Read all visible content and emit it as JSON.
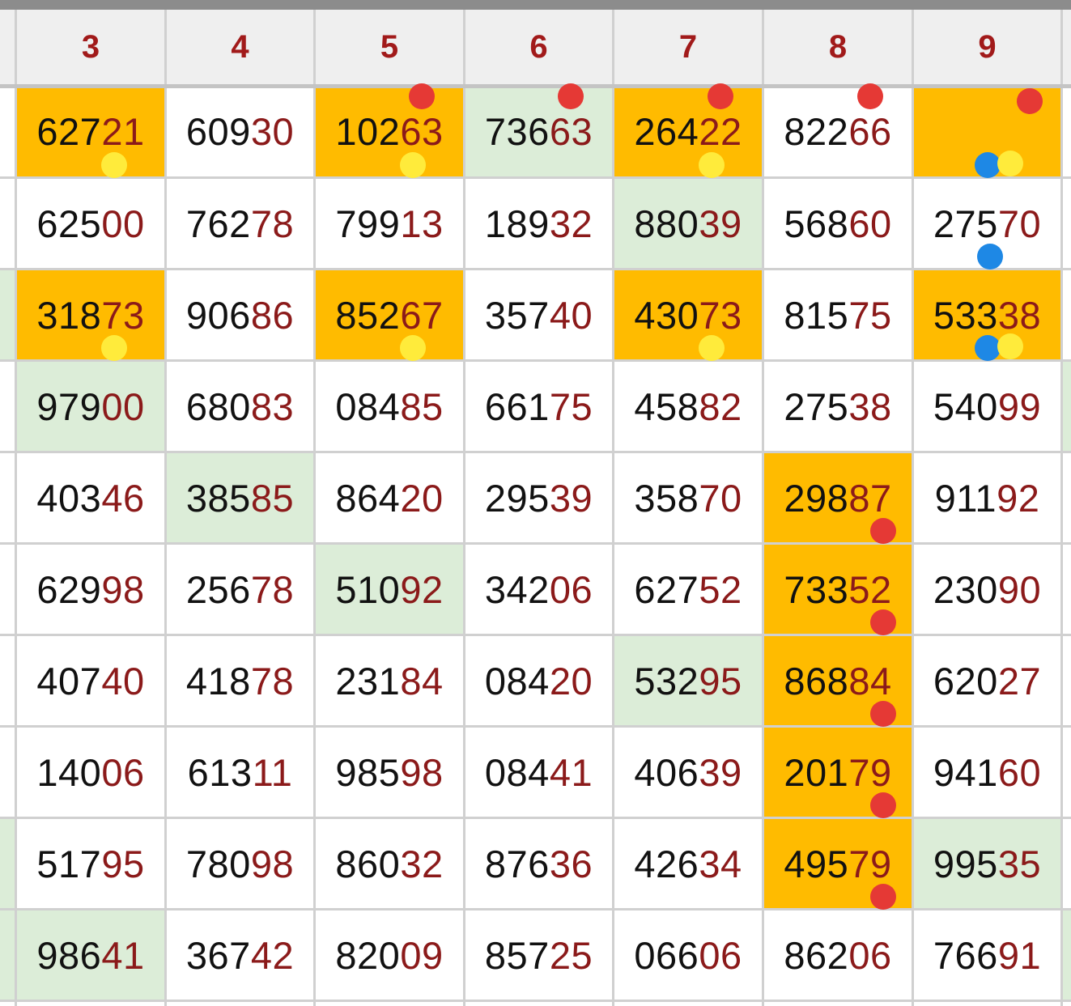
{
  "headers": [
    "3",
    "4",
    "5",
    "6",
    "7",
    "8",
    "9"
  ],
  "rows": [
    [
      "62721",
      "60930",
      "10263",
      "73663",
      "26422",
      "82266",
      ""
    ],
    [
      "62500",
      "76278",
      "79913",
      "18932",
      "88039",
      "56860",
      "27570"
    ],
    [
      "31873",
      "90686",
      "85267",
      "35740",
      "43073",
      "81575",
      "53338"
    ],
    [
      "97900",
      "68083",
      "08485",
      "66175",
      "45882",
      "27538",
      "54099"
    ],
    [
      "40346",
      "38585",
      "86420",
      "29539",
      "35870",
      "29887",
      "91192"
    ],
    [
      "62998",
      "25678",
      "51092",
      "34206",
      "62752",
      "73352",
      "23090"
    ],
    [
      "40740",
      "41878",
      "23184",
      "08420",
      "53295",
      "86884",
      "62027"
    ],
    [
      "14006",
      "61311",
      "98598",
      "08441",
      "40639",
      "20179",
      "94160"
    ],
    [
      "51795",
      "78098",
      "86032",
      "87636",
      "42634",
      "49579",
      "99535"
    ],
    [
      "98641",
      "36742",
      "82009",
      "85725",
      "06606",
      "86206",
      "76691"
    ]
  ],
  "fills": [
    [
      "orange",
      "",
      "orange",
      "green",
      "orange",
      "",
      "orange"
    ],
    [
      "",
      "",
      "",
      "",
      "green",
      "",
      ""
    ],
    [
      "orange",
      "",
      "orange",
      "",
      "orange",
      "",
      "orange"
    ],
    [
      "green",
      "",
      "",
      "",
      "",
      "",
      ""
    ],
    [
      "",
      "green",
      "",
      "",
      "",
      "orange",
      ""
    ],
    [
      "",
      "",
      "green",
      "",
      "",
      "orange",
      ""
    ],
    [
      "",
      "",
      "",
      "",
      "green",
      "orange",
      ""
    ],
    [
      "",
      "",
      "",
      "",
      "",
      "orange",
      ""
    ],
    [
      "",
      "",
      "",
      "",
      "",
      "orange",
      "green"
    ],
    [
      "green",
      "",
      "",
      "",
      "",
      "",
      ""
    ]
  ],
  "markers": [
    {
      "row": 0,
      "col": 0,
      "color": "yellow",
      "pos": "bottom"
    },
    {
      "row": 0,
      "col": 2,
      "color": "red",
      "pos": "top"
    },
    {
      "row": 0,
      "col": 2,
      "color": "yellow",
      "pos": "bottom"
    },
    {
      "row": 0,
      "col": 3,
      "color": "red",
      "pos": "top"
    },
    {
      "row": 0,
      "col": 4,
      "color": "red",
      "pos": "top"
    },
    {
      "row": 0,
      "col": 4,
      "color": "yellow",
      "pos": "bottom"
    },
    {
      "row": 0,
      "col": 5,
      "color": "red",
      "pos": "top"
    },
    {
      "row": 0,
      "col": 6,
      "color": "red",
      "pos": "top"
    },
    {
      "row": 0,
      "col": 6,
      "color": "blue",
      "pos": "bottom-left"
    },
    {
      "row": 0,
      "col": 6,
      "color": "yellow",
      "pos": "bottom-right"
    },
    {
      "row": 1,
      "col": 6,
      "color": "blue",
      "pos": "bottom"
    },
    {
      "row": 2,
      "col": 0,
      "color": "yellow",
      "pos": "bottom"
    },
    {
      "row": 2,
      "col": 2,
      "color": "yellow",
      "pos": "bottom"
    },
    {
      "row": 2,
      "col": 4,
      "color": "yellow",
      "pos": "bottom"
    },
    {
      "row": 2,
      "col": 6,
      "color": "blue",
      "pos": "bottom-left"
    },
    {
      "row": 2,
      "col": 6,
      "color": "yellow",
      "pos": "bottom-right"
    },
    {
      "row": 4,
      "col": 5,
      "color": "red",
      "pos": "bottom"
    },
    {
      "row": 5,
      "col": 5,
      "color": "red",
      "pos": "bottom"
    },
    {
      "row": 6,
      "col": 5,
      "color": "red",
      "pos": "bottom"
    },
    {
      "row": 7,
      "col": 5,
      "color": "red",
      "pos": "bottom"
    },
    {
      "row": 8,
      "col": 5,
      "color": "red",
      "pos": "bottom"
    }
  ],
  "colors": {
    "orange": "#ffbb00",
    "green": "#dcedd8",
    "header_bg": "#efefef",
    "header_text": "#a11a1a",
    "digit_dark": "#111111",
    "digit_red": "#8b1a1a",
    "grid_line": "#d0d0d0",
    "dot_red": "#e53935",
    "dot_yellow": "#ffeb3b",
    "dot_blue": "#1e88e5"
  }
}
